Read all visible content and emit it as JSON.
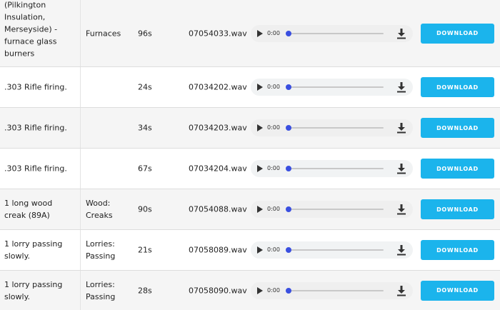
{
  "rows": [
    {
      "description": "(Pilkington Insulation, Merseyside) - furnace glass burners",
      "category": "Furnaces",
      "duration": "96s",
      "file": "07054033.wav",
      "time": "0:00",
      "button": "DOWNLOAD"
    },
    {
      "description": ".303 Rifle firing.",
      "category": "",
      "duration": "24s",
      "file": "07034202.wav",
      "time": "0:00",
      "button": "DOWNLOAD"
    },
    {
      "description": ".303 Rifle firing.",
      "category": "",
      "duration": "34s",
      "file": "07034203.wav",
      "time": "0:00",
      "button": "DOWNLOAD"
    },
    {
      "description": ".303 Rifle firing.",
      "category": "",
      "duration": "67s",
      "file": "07034204.wav",
      "time": "0:00",
      "button": "DOWNLOAD"
    },
    {
      "description": "1 long wood creak (89A)",
      "category": "Wood: Creaks",
      "duration": "90s",
      "file": "07054088.wav",
      "time": "0:00",
      "button": "DOWNLOAD"
    },
    {
      "description": "1 lorry passing slowly.",
      "category": "Lorries: Passing",
      "duration": "21s",
      "file": "07058089.wav",
      "time": "0:00",
      "button": "DOWNLOAD"
    },
    {
      "description": "1 lorry passing slowly.",
      "category": "Lorries: Passing",
      "duration": "28s",
      "file": "07058090.wav",
      "time": "0:00",
      "button": "DOWNLOAD"
    }
  ],
  "colors": {
    "accent": "#1bb4ec",
    "progress_knob": "#3a4fe0",
    "alt_row": "#f5f5f5"
  },
  "icons": {
    "play": "play-icon",
    "download": "download-icon"
  }
}
